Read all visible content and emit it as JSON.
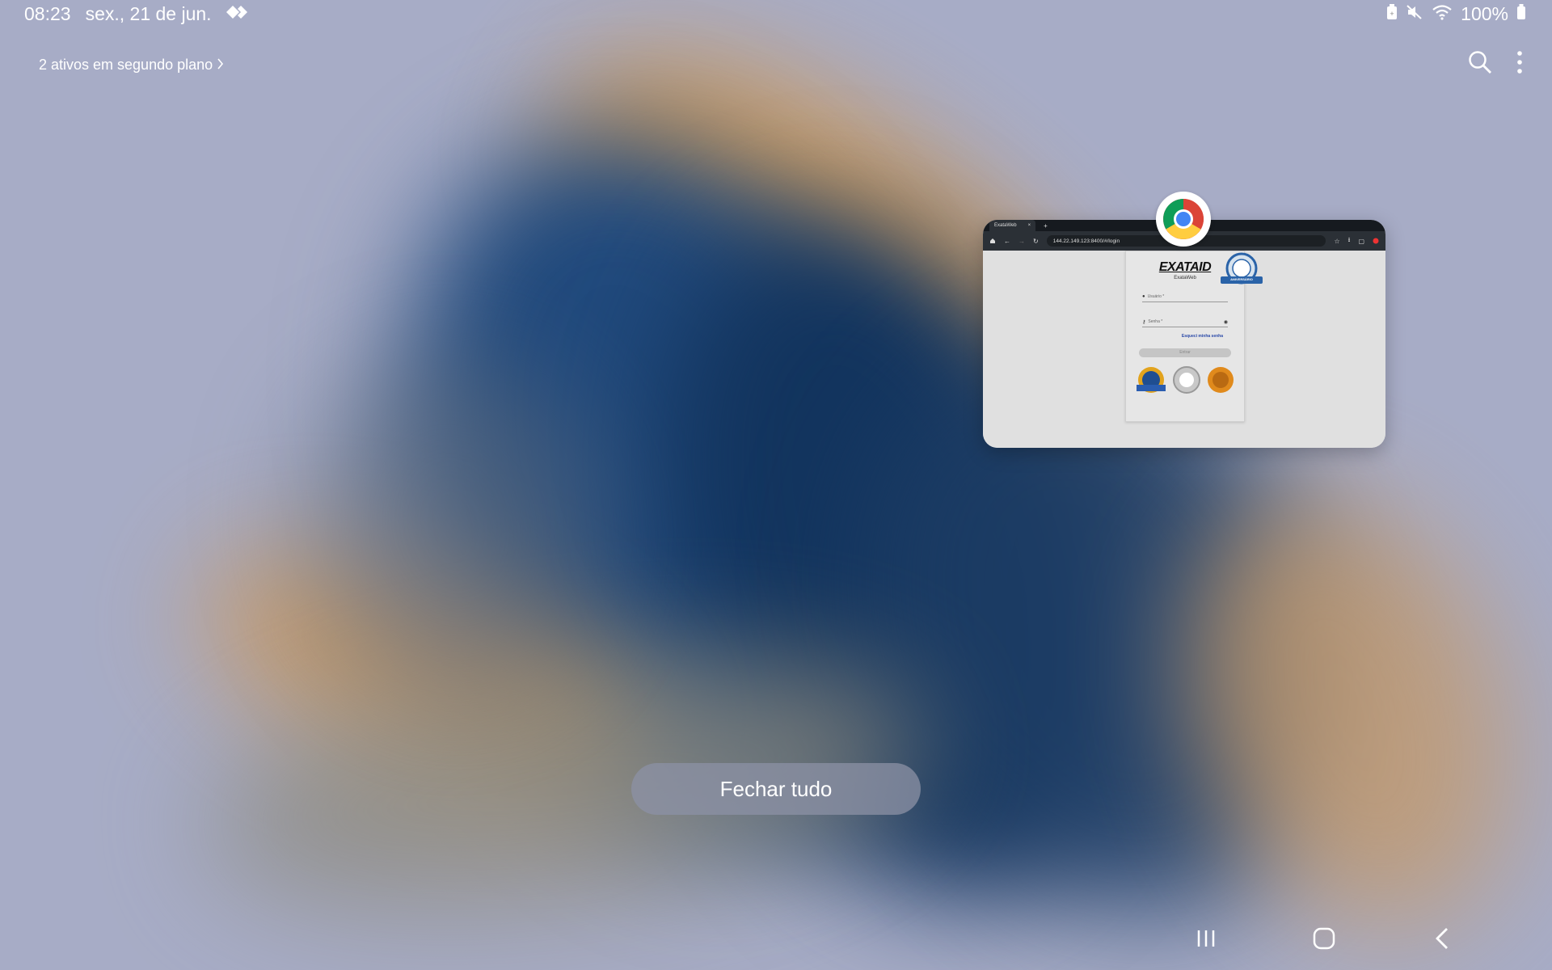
{
  "status_bar": {
    "time": "08:23",
    "date": "sex., 21 de jun.",
    "battery_percent": "100%",
    "icons": [
      "diamond-icon",
      "battery-saver-icon",
      "mute-icon",
      "wifi-icon",
      "battery-icon"
    ]
  },
  "recents": {
    "background_link": "2 ativos em segundo plano",
    "search_icon": "search-icon",
    "menu_icon": "more-vert-icon"
  },
  "app_card": {
    "app_icon": "chrome-icon",
    "browser_tab_title": "ExataWeb",
    "url": "144.22.149.123:8400/#/login",
    "page": {
      "logo_text": "EXATAID",
      "logo_subtitle": "ExataWeb",
      "username_placeholder": "Usuário *",
      "password_placeholder": "Senha *",
      "forgot_password": "Esqueci minha senha",
      "submit_label": "Entrar",
      "anniversary_badge": "ANIVERSÁRIO"
    }
  },
  "close_all_label": "Fechar tudo",
  "navbar": {
    "recents_icon": "recents-icon",
    "home_icon": "home-icon",
    "back_icon": "back-icon"
  },
  "colors": {
    "wallpaper_base": "#a7acc6",
    "wallpaper_blue": "#1d4577",
    "wallpaper_orange": "#d89a4f",
    "button_bg": "#8c92a5"
  }
}
